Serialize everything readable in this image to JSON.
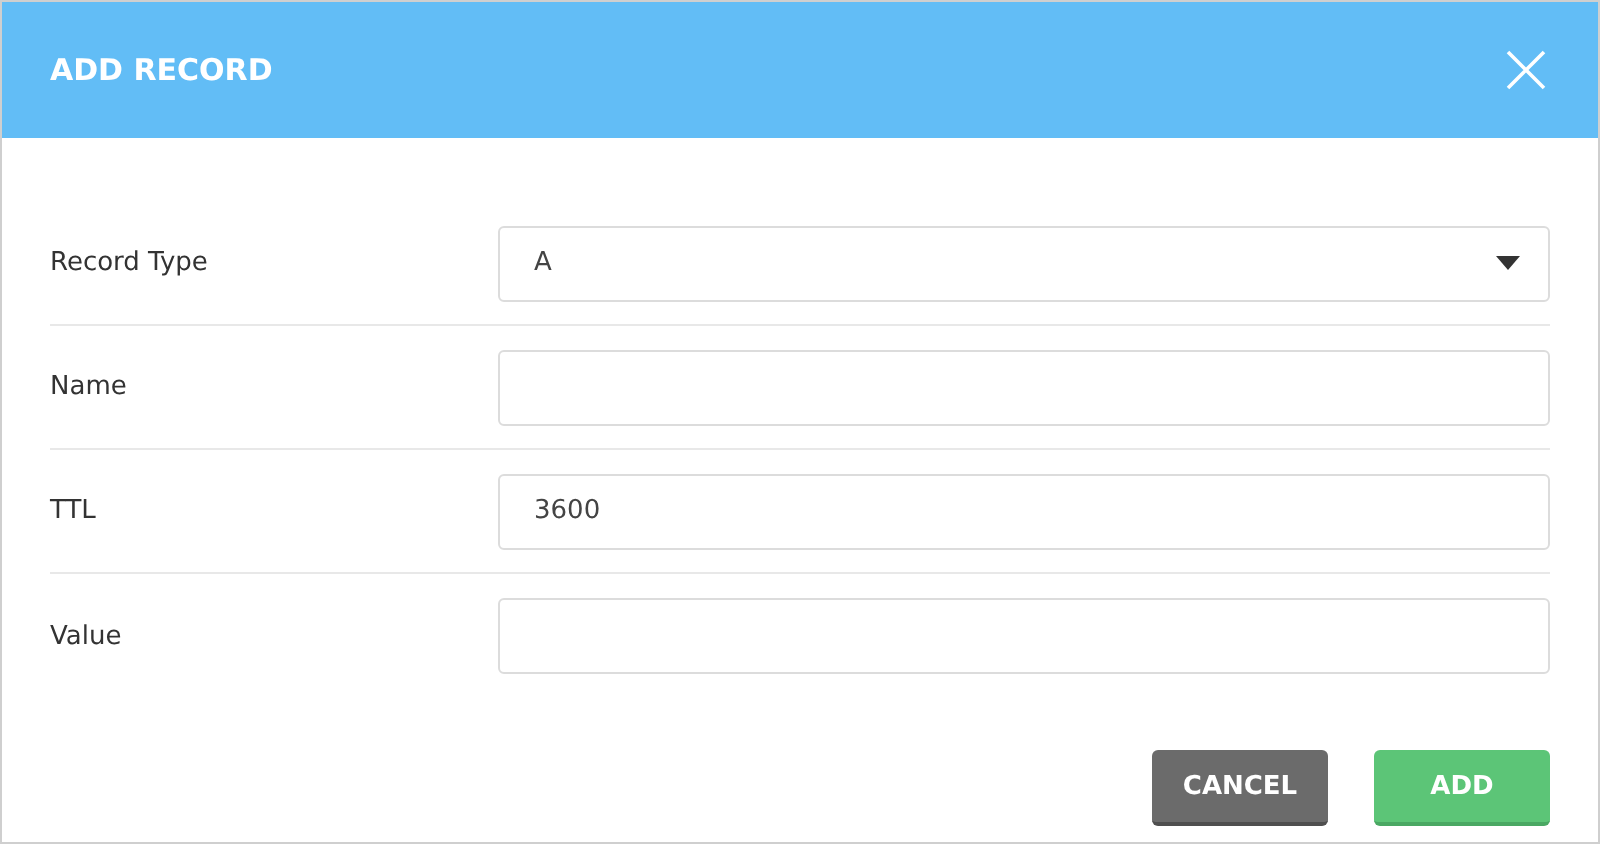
{
  "dialog": {
    "title": "ADD RECORD"
  },
  "fields": [
    {
      "label": "Record Type",
      "kind": "select",
      "value": "A"
    },
    {
      "label": "Name",
      "kind": "text"
    },
    {
      "label": "TTL",
      "kind": "text",
      "value": "3600"
    },
    {
      "label": "Value",
      "kind": "text"
    }
  ],
  "buttons": [
    {
      "label": "CANCEL",
      "kind": "secondary"
    },
    {
      "label": "ADD",
      "kind": "primary"
    }
  ]
}
